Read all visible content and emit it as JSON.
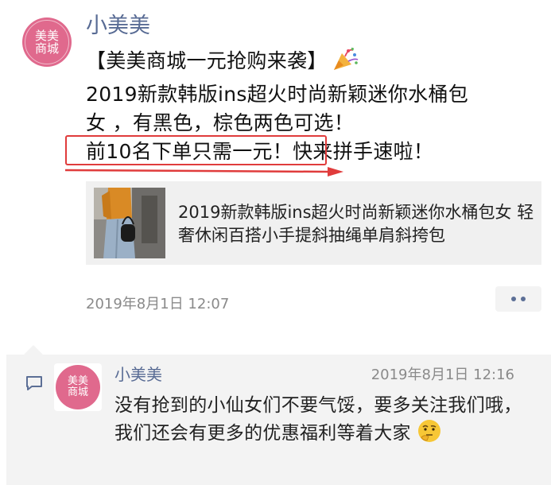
{
  "post": {
    "avatar_text_line1": "美美",
    "avatar_text_line2": "商城",
    "author": "小美美",
    "line1": "【美美商城一元抢购来袭】",
    "party_icon": "party-popper-icon",
    "line2": "2019新款韩版ins超火时尚新颖迷你水桶包",
    "line3": "女 ，有黑色，棕色两色可选！",
    "line4_highlight": "前10名下单只需一元！",
    "line4_rest": "快来拼手速啦！",
    "link_title": "2019新款韩版ins超火时尚新颖迷你水桶包女 轻奢休闲百搭小手提斜抽绳单肩斜挎包",
    "time": "2019年8月1日 12:07",
    "more_icon": "more-dots-icon"
  },
  "comment": {
    "icon": "comment-bubble-icon",
    "avatar_text_line1": "美美",
    "avatar_text_line2": "商城",
    "author": "小美美",
    "time": "2019年8月1日 12:16",
    "text": "没有抢到的小仙女们不要气馁，要多关注我们哦，我们还会有更多的优惠福利等着大家",
    "emoji": "thinking-face-emoji"
  },
  "colors": {
    "name_blue": "#586b94",
    "highlight_red": "#e03c3c",
    "avatar_pink": "#e0698d"
  }
}
